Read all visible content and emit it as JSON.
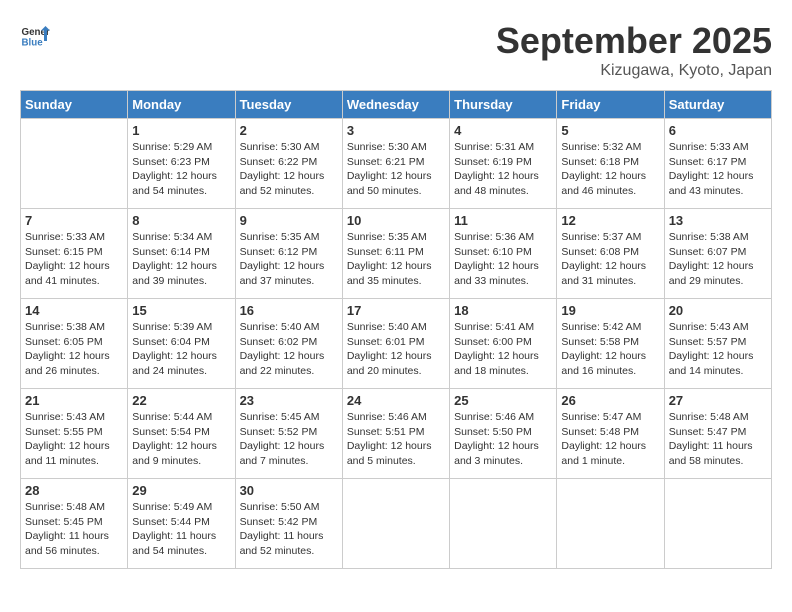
{
  "header": {
    "logo_line1": "General",
    "logo_line2": "Blue",
    "month": "September 2025",
    "location": "Kizugawa, Kyoto, Japan"
  },
  "weekdays": [
    "Sunday",
    "Monday",
    "Tuesday",
    "Wednesday",
    "Thursday",
    "Friday",
    "Saturday"
  ],
  "weeks": [
    [
      {
        "day": "",
        "info": ""
      },
      {
        "day": "1",
        "info": "Sunrise: 5:29 AM\nSunset: 6:23 PM\nDaylight: 12 hours\nand 54 minutes."
      },
      {
        "day": "2",
        "info": "Sunrise: 5:30 AM\nSunset: 6:22 PM\nDaylight: 12 hours\nand 52 minutes."
      },
      {
        "day": "3",
        "info": "Sunrise: 5:30 AM\nSunset: 6:21 PM\nDaylight: 12 hours\nand 50 minutes."
      },
      {
        "day": "4",
        "info": "Sunrise: 5:31 AM\nSunset: 6:19 PM\nDaylight: 12 hours\nand 48 minutes."
      },
      {
        "day": "5",
        "info": "Sunrise: 5:32 AM\nSunset: 6:18 PM\nDaylight: 12 hours\nand 46 minutes."
      },
      {
        "day": "6",
        "info": "Sunrise: 5:33 AM\nSunset: 6:17 PM\nDaylight: 12 hours\nand 43 minutes."
      }
    ],
    [
      {
        "day": "7",
        "info": "Sunrise: 5:33 AM\nSunset: 6:15 PM\nDaylight: 12 hours\nand 41 minutes."
      },
      {
        "day": "8",
        "info": "Sunrise: 5:34 AM\nSunset: 6:14 PM\nDaylight: 12 hours\nand 39 minutes."
      },
      {
        "day": "9",
        "info": "Sunrise: 5:35 AM\nSunset: 6:12 PM\nDaylight: 12 hours\nand 37 minutes."
      },
      {
        "day": "10",
        "info": "Sunrise: 5:35 AM\nSunset: 6:11 PM\nDaylight: 12 hours\nand 35 minutes."
      },
      {
        "day": "11",
        "info": "Sunrise: 5:36 AM\nSunset: 6:10 PM\nDaylight: 12 hours\nand 33 minutes."
      },
      {
        "day": "12",
        "info": "Sunrise: 5:37 AM\nSunset: 6:08 PM\nDaylight: 12 hours\nand 31 minutes."
      },
      {
        "day": "13",
        "info": "Sunrise: 5:38 AM\nSunset: 6:07 PM\nDaylight: 12 hours\nand 29 minutes."
      }
    ],
    [
      {
        "day": "14",
        "info": "Sunrise: 5:38 AM\nSunset: 6:05 PM\nDaylight: 12 hours\nand 26 minutes."
      },
      {
        "day": "15",
        "info": "Sunrise: 5:39 AM\nSunset: 6:04 PM\nDaylight: 12 hours\nand 24 minutes."
      },
      {
        "day": "16",
        "info": "Sunrise: 5:40 AM\nSunset: 6:02 PM\nDaylight: 12 hours\nand 22 minutes."
      },
      {
        "day": "17",
        "info": "Sunrise: 5:40 AM\nSunset: 6:01 PM\nDaylight: 12 hours\nand 20 minutes."
      },
      {
        "day": "18",
        "info": "Sunrise: 5:41 AM\nSunset: 6:00 PM\nDaylight: 12 hours\nand 18 minutes."
      },
      {
        "day": "19",
        "info": "Sunrise: 5:42 AM\nSunset: 5:58 PM\nDaylight: 12 hours\nand 16 minutes."
      },
      {
        "day": "20",
        "info": "Sunrise: 5:43 AM\nSunset: 5:57 PM\nDaylight: 12 hours\nand 14 minutes."
      }
    ],
    [
      {
        "day": "21",
        "info": "Sunrise: 5:43 AM\nSunset: 5:55 PM\nDaylight: 12 hours\nand 11 minutes."
      },
      {
        "day": "22",
        "info": "Sunrise: 5:44 AM\nSunset: 5:54 PM\nDaylight: 12 hours\nand 9 minutes."
      },
      {
        "day": "23",
        "info": "Sunrise: 5:45 AM\nSunset: 5:52 PM\nDaylight: 12 hours\nand 7 minutes."
      },
      {
        "day": "24",
        "info": "Sunrise: 5:46 AM\nSunset: 5:51 PM\nDaylight: 12 hours\nand 5 minutes."
      },
      {
        "day": "25",
        "info": "Sunrise: 5:46 AM\nSunset: 5:50 PM\nDaylight: 12 hours\nand 3 minutes."
      },
      {
        "day": "26",
        "info": "Sunrise: 5:47 AM\nSunset: 5:48 PM\nDaylight: 12 hours\nand 1 minute."
      },
      {
        "day": "27",
        "info": "Sunrise: 5:48 AM\nSunset: 5:47 PM\nDaylight: 11 hours\nand 58 minutes."
      }
    ],
    [
      {
        "day": "28",
        "info": "Sunrise: 5:48 AM\nSunset: 5:45 PM\nDaylight: 11 hours\nand 56 minutes."
      },
      {
        "day": "29",
        "info": "Sunrise: 5:49 AM\nSunset: 5:44 PM\nDaylight: 11 hours\nand 54 minutes."
      },
      {
        "day": "30",
        "info": "Sunrise: 5:50 AM\nSunset: 5:42 PM\nDaylight: 11 hours\nand 52 minutes."
      },
      {
        "day": "",
        "info": ""
      },
      {
        "day": "",
        "info": ""
      },
      {
        "day": "",
        "info": ""
      },
      {
        "day": "",
        "info": ""
      }
    ]
  ]
}
